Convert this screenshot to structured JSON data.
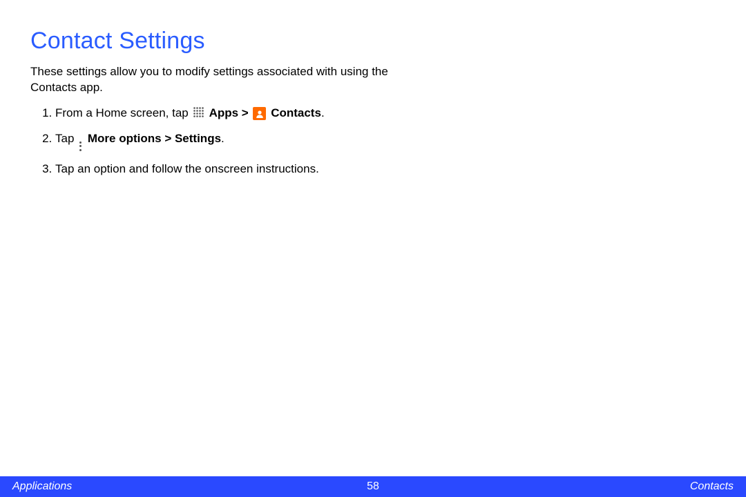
{
  "title": "Contact Settings",
  "intro": "These settings allow you to modify settings associated with using the Contacts app.",
  "steps": [
    {
      "prefix": "From a Home screen, tap",
      "apps_label": " Apps >",
      "contacts_label": " Contacts",
      "suffix": "."
    },
    {
      "prefix": "Tap",
      "more_label": " More options > Settings",
      "suffix": "."
    },
    {
      "full": "Tap an option and follow the onscreen instructions."
    }
  ],
  "footer": {
    "left": "Applications",
    "center": "58",
    "right": "Contacts"
  }
}
